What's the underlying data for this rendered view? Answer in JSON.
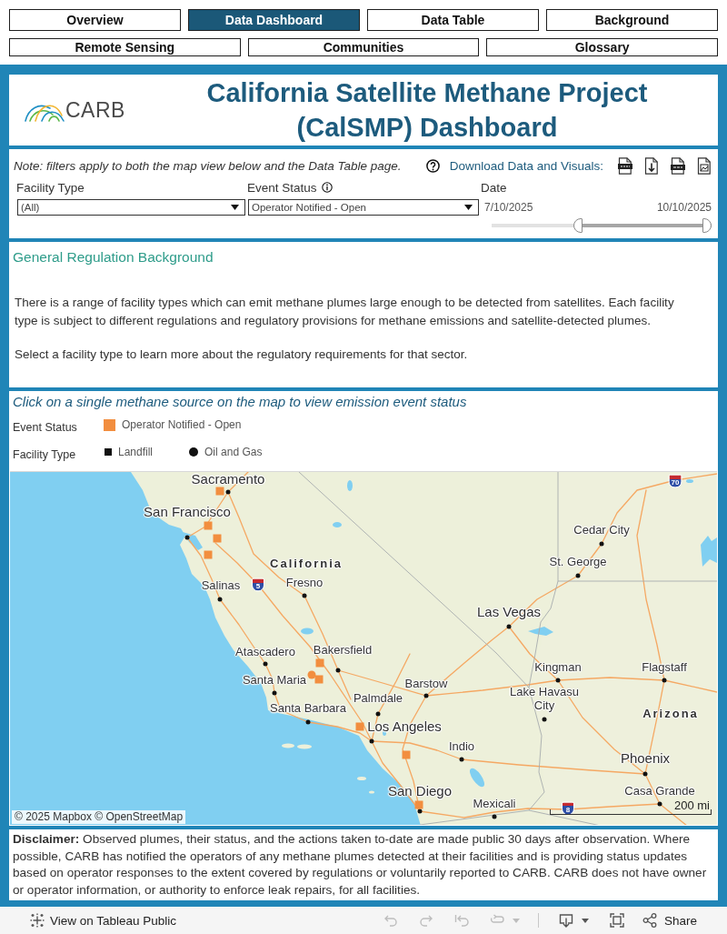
{
  "nav_rows": [
    {
      "tabs": [
        {
          "label": "Overview",
          "selected": false
        },
        {
          "label": "Data Dashboard",
          "selected": true
        },
        {
          "label": "Data Table",
          "selected": false
        },
        {
          "label": "Background",
          "selected": false
        }
      ]
    },
    {
      "tabs": [
        {
          "label": "Remote Sensing",
          "selected": false
        },
        {
          "label": "Communities",
          "selected": false
        },
        {
          "label": "Glossary",
          "selected": false
        }
      ]
    }
  ],
  "header": {
    "logo_text": "CARB",
    "title": "California Satellite Methane Project (CalSMP) Dashboard"
  },
  "filters_panel": {
    "note": "Note: filters apply to both the map view below and the Data Table page.",
    "download_label": "Download Data and Visuals:",
    "downloads": [
      {
        "kind": "csv"
      },
      {
        "kind": "pdf"
      },
      {
        "kind": "ppt"
      },
      {
        "kind": "image"
      }
    ],
    "filters": [
      {
        "label": "Facility Type",
        "value": "(All)",
        "info": false
      },
      {
        "label": "Event Status",
        "value": "Operator Notified - Open",
        "info": true
      }
    ],
    "date": {
      "label": "Date",
      "start": "7/10/2025",
      "end": "10/10/2025",
      "handles": [
        {
          "level": 0.4
        },
        {
          "level": 1
        }
      ]
    }
  },
  "background": {
    "heading": "General Regulation Background",
    "paragraphs": [
      "There is a range of facility types which can emit methane plumes large enough to be detected from satellites. Each facility type is subject to different regulations and regulatory provisions for methane emissions and satellite-detected plumes.",
      "Select a facility type to learn more about the regulatory requirements for that sector."
    ]
  },
  "map_section": {
    "title": "Click on a single methane source on the map to view emission event status",
    "legend": [
      {
        "label": "Event Status",
        "items": [
          {
            "kind": "swatch",
            "label": "Operator Notified - Open",
            "color": "#f28e3f"
          }
        ]
      },
      {
        "label": "Facility Type",
        "items": [
          {
            "kind": "square",
            "label": "Landfill"
          },
          {
            "kind": "circle",
            "label": "Oil and Gas"
          }
        ]
      }
    ],
    "map": {
      "places": [
        {
          "name": "Sacramento",
          "kind": "major_city"
        },
        {
          "name": "San Francisco",
          "kind": "major_city"
        },
        {
          "name": "Cedar City",
          "kind": "city"
        },
        {
          "name": "California",
          "kind": "state"
        },
        {
          "name": "St. George",
          "kind": "city"
        },
        {
          "name": "Salinas",
          "kind": "city"
        },
        {
          "name": "Fresno",
          "kind": "city"
        },
        {
          "name": "Las Vegas",
          "kind": "major_city"
        },
        {
          "name": "Atascadero",
          "kind": "city"
        },
        {
          "name": "Bakersfield",
          "kind": "city"
        },
        {
          "name": "Kingman",
          "kind": "city"
        },
        {
          "name": "Flagstaff",
          "kind": "city"
        },
        {
          "name": "Santa Maria",
          "kind": "city"
        },
        {
          "name": "Barstow",
          "kind": "city"
        },
        {
          "name": "Santa Barbara",
          "kind": "city"
        },
        {
          "name": "Palmdale",
          "kind": "city"
        },
        {
          "name": "Lake Havasu City",
          "kind": "city"
        },
        {
          "name": "Los Angeles",
          "kind": "major_city"
        },
        {
          "name": "Arizona",
          "kind": "state"
        },
        {
          "name": "Indio",
          "kind": "city"
        },
        {
          "name": "Phoenix",
          "kind": "major_city"
        },
        {
          "name": "San Diego",
          "kind": "major_city"
        },
        {
          "name": "Mexicali",
          "kind": "city"
        },
        {
          "name": "Casa Grande",
          "kind": "city"
        }
      ],
      "highways": [
        {
          "label": "5"
        },
        {
          "label": "70"
        },
        {
          "label": "8"
        }
      ],
      "markers": [
        {
          "kind": "landfill"
        },
        {
          "kind": "landfill"
        },
        {
          "kind": "landfill"
        },
        {
          "kind": "landfill"
        },
        {
          "kind": "landfill"
        },
        {
          "kind": "oil_and_gas"
        },
        {
          "kind": "landfill"
        },
        {
          "kind": "landfill"
        },
        {
          "kind": "landfill"
        },
        {
          "kind": "landfill"
        }
      ],
      "attribution": "© 2025 Mapbox © OpenStreetMap",
      "scale": "200 mi"
    }
  },
  "disclaimer": "**Disclaimer:** Observed plumes, their status, and the actions taken to-date are made public 30 days after observation. Where possible, CARB has notified the operators of any methane plumes detected at their facilities and is providing status updates based on operator responses to the extent covered by regulations or voluntarily reported to CARB. CARB does not have owner or operator information, or authority to enforce leak repairs, for all facilities.",
  "footer": {
    "view_link": "View on Tableau Public",
    "toolbar": [
      {
        "kind": "undo",
        "disabled": true,
        "caret": false
      },
      {
        "kind": "redo",
        "disabled": true,
        "caret": false
      },
      {
        "kind": "revert",
        "disabled": true,
        "caret": false
      },
      {
        "kind": "loop",
        "disabled": true,
        "caret": true
      },
      {
        "kind": "download",
        "disabled": false,
        "caret": true
      },
      {
        "kind": "fullscreen",
        "disabled": false,
        "caret": false
      }
    ],
    "share": "Share"
  }
}
